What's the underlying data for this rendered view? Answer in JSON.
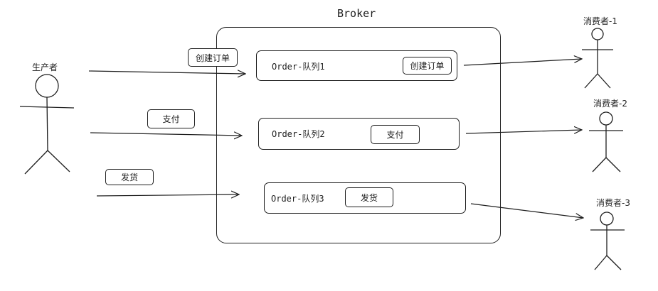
{
  "broker": {
    "title": "Broker"
  },
  "producer": {
    "label": "生产者"
  },
  "messages": [
    {
      "label": "创建订单"
    },
    {
      "label": "支付"
    },
    {
      "label": "发货"
    }
  ],
  "queues": [
    {
      "label": "Order-队列1",
      "message": "创建订单"
    },
    {
      "label": "Order-队列2",
      "message": "支付"
    },
    {
      "label": "Order-队列3",
      "message": "发货"
    }
  ],
  "consumers": [
    {
      "label": "消费者-1"
    },
    {
      "label": "消费者-2"
    },
    {
      "label": "消费者-3"
    }
  ],
  "stroke_color": "#1e1e1e"
}
